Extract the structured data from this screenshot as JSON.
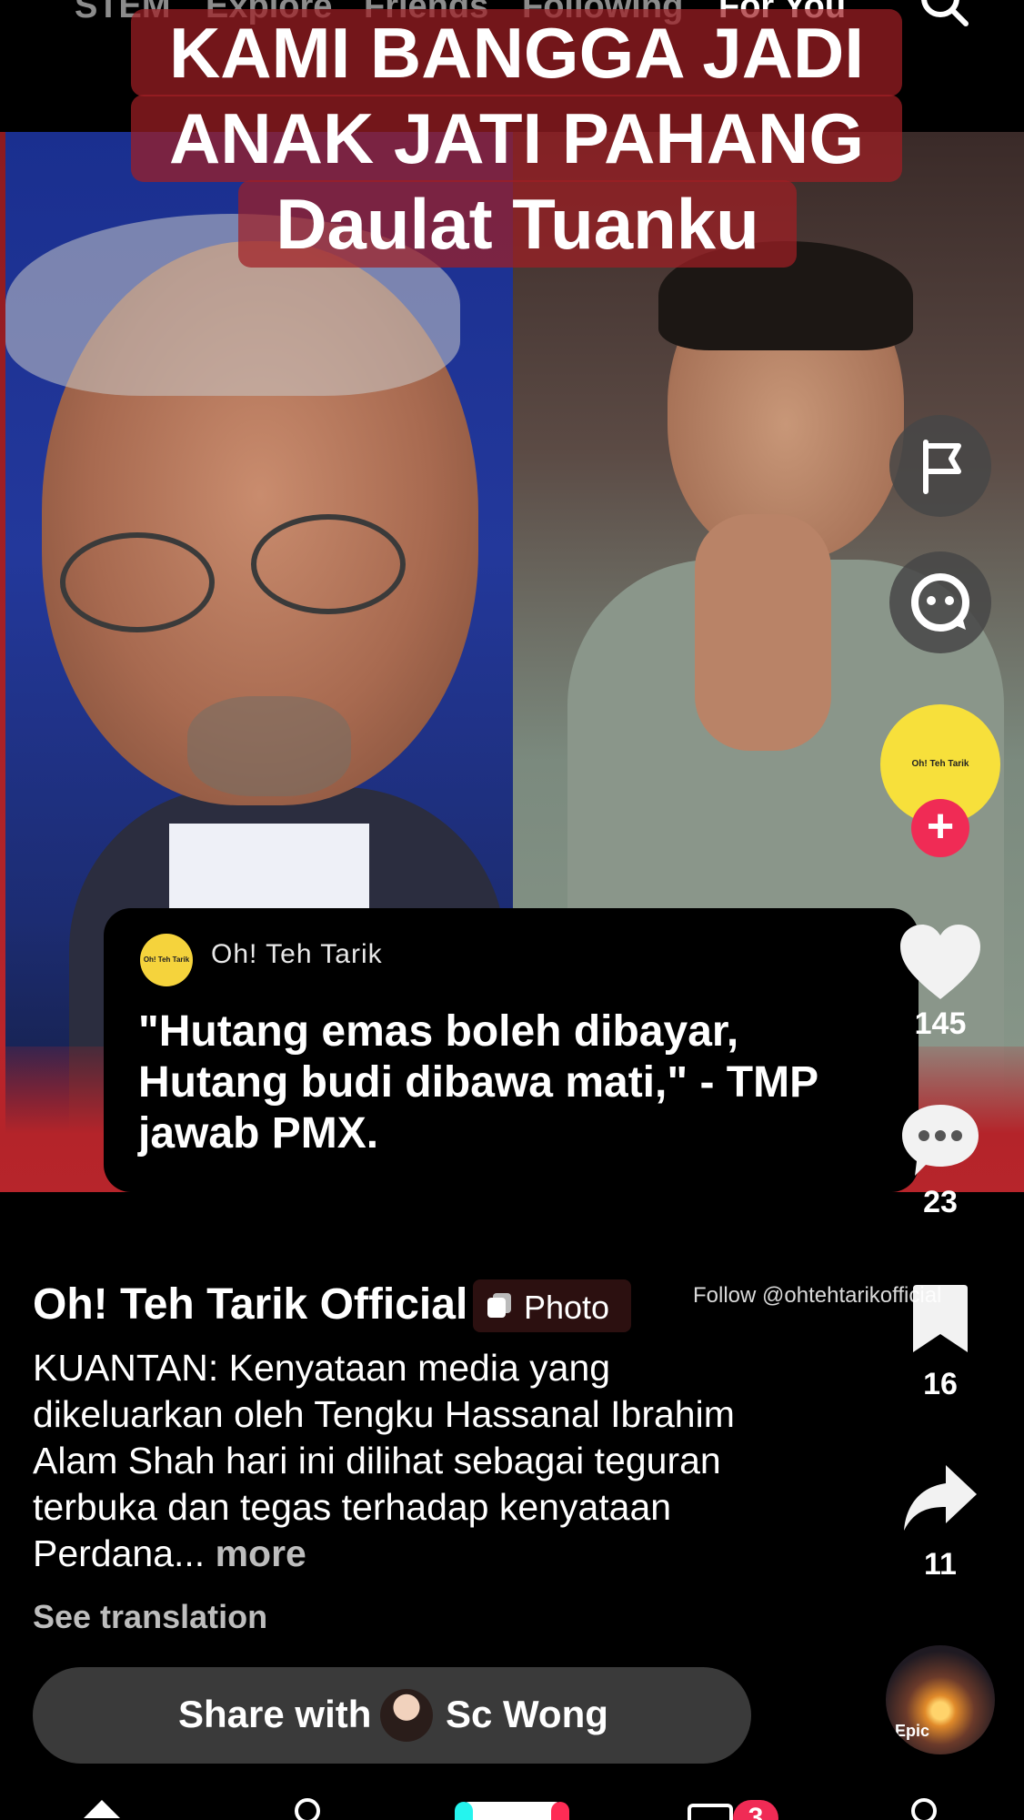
{
  "top_nav": {
    "tabs": [
      "STEM",
      "Explore",
      "Friends",
      "Following",
      "For You"
    ],
    "active_tab": "For You"
  },
  "headline": {
    "line1": "KAMI BANGGA JADI",
    "line2": "ANAK JATI PAHANG",
    "line3": "Daulat Tuanku"
  },
  "quote_card": {
    "avatar_text": "Oh! Teh Tarik",
    "name": "Oh! Teh Tarik",
    "quote": "\"Hutang emas boleh dibayar, Hutang budi dibawa mati,\" - TMP jawab PMX."
  },
  "right_rail": {
    "author_avatar_text": "Oh! Teh Tarik",
    "likes": "145",
    "comments": "23",
    "saves": "16",
    "shares": "11"
  },
  "post": {
    "author": "Oh! Teh Tarik Official",
    "badge": "Photo",
    "watermark": "Follow @ohtehtarikofficial",
    "caption": "KUANTAN: Kenyataan media yang dikeluarkan oleh Tengku Hassanal Ibrahim Alam Shah hari ini dilihat sebagai teguran terbuka dan tegas terhadap kenyataan Perdana...",
    "more": "more",
    "see_translation": "See translation"
  },
  "share": {
    "label": "Share with",
    "contact": "Sc Wong"
  },
  "music": {
    "label": "Epic"
  },
  "bottom_nav": {
    "inbox_badge": "3"
  },
  "colors": {
    "accent": "#f02b55",
    "banner_red": "#b4242a",
    "avatar_yellow": "#f5d33c"
  }
}
